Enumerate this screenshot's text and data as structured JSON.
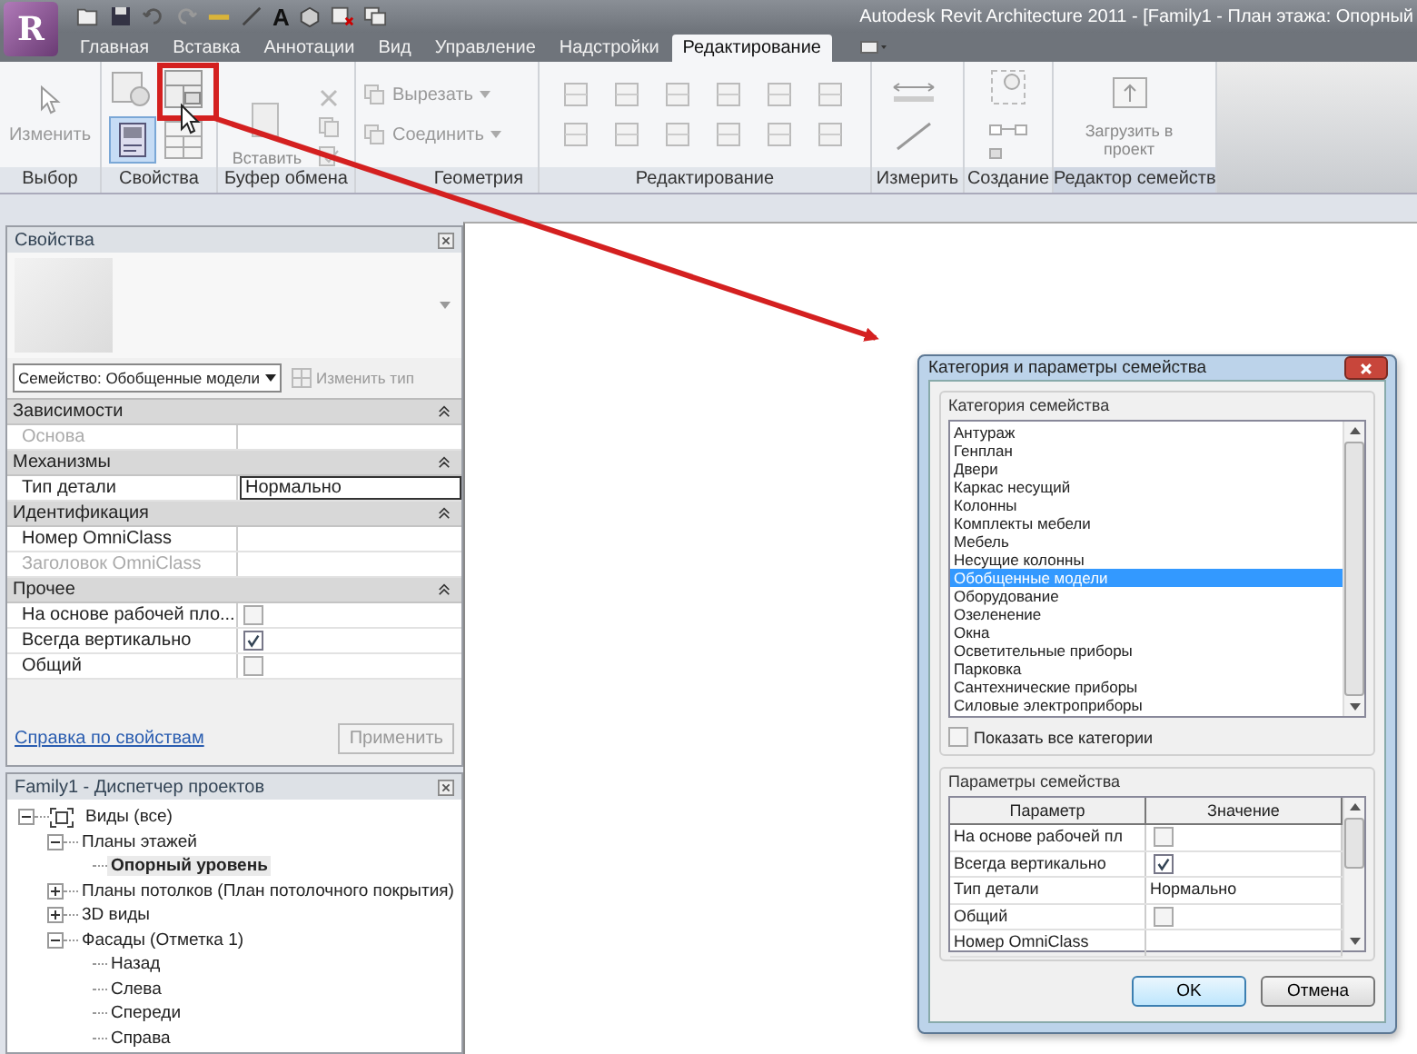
{
  "app": {
    "logo": "R",
    "title": "Autodesk Revit Architecture 2011 - [Family1 - План этажа: Опорный"
  },
  "quick_access": {
    "text_tool": "A"
  },
  "tabs": [
    {
      "label": "Главная",
      "selected": false
    },
    {
      "label": "Вставка",
      "selected": false
    },
    {
      "label": "Аннотации",
      "selected": false
    },
    {
      "label": "Вид",
      "selected": false
    },
    {
      "label": "Управление",
      "selected": false
    },
    {
      "label": "Надстройки",
      "selected": false
    },
    {
      "label": "Редактирование",
      "selected": true
    }
  ],
  "ribbon": {
    "panels": [
      {
        "label": "Выбор",
        "buttons": [
          "Изменить"
        ]
      },
      {
        "label": "Свойства",
        "toggle_on": true
      },
      {
        "label": "Буфер обмена",
        "buttons": [
          "Вставить"
        ]
      },
      {
        "label": "Геометрия",
        "buttons": [
          "Вырезать",
          "Соединить"
        ]
      },
      {
        "label": "Редактирование"
      },
      {
        "label": "Измерить"
      },
      {
        "label": "Создание"
      },
      {
        "label": "Редактор семейств",
        "buttons": [
          "Загрузить в проект"
        ]
      }
    ]
  },
  "properties": {
    "title": "Свойства",
    "family_selector": "Семейство: Обобщенные модели",
    "edit_type": "Изменить тип",
    "groups": [
      {
        "name": "Зависимости",
        "rows": [
          {
            "label": "Основа",
            "kind": "text",
            "disabled": true
          }
        ]
      },
      {
        "name": "Механизмы",
        "rows": [
          {
            "label": "Тип детали",
            "kind": "text",
            "value": "Нормально",
            "disabled": false
          }
        ]
      },
      {
        "name": "Идентификация",
        "rows": [
          {
            "label": "Номер OmniClass",
            "kind": "text",
            "disabled": false
          },
          {
            "label": "Заголовок OmniClass",
            "kind": "text",
            "disabled": true
          }
        ]
      },
      {
        "name": "Прочее",
        "rows": [
          {
            "label": "На основе рабочей пло...",
            "kind": "checkbox",
            "checked": false,
            "disabled": false
          },
          {
            "label": "Всегда вертикально",
            "kind": "checkbox",
            "checked": true,
            "disabled": false
          },
          {
            "label": "Общий",
            "kind": "checkbox",
            "checked": false,
            "disabled": false
          }
        ]
      }
    ],
    "help_link": "Справка по свойствам",
    "apply": "Применить"
  },
  "browser": {
    "title": "Family1 - Диспетчер проектов",
    "tree": [
      {
        "label": "Виды (все)",
        "expanded": true,
        "selected": false,
        "children": [
          {
            "label": "Планы этажей",
            "expanded": true,
            "selected": false,
            "children": [
              {
                "label": "Опорный уровень",
                "selected": true
              }
            ]
          },
          {
            "label": "Планы потолков (План потолочного покрытия)",
            "expanded": false,
            "selected": false
          },
          {
            "label": "3D виды",
            "expanded": false,
            "selected": false
          },
          {
            "label": "Фасады (Отметка 1)",
            "expanded": true,
            "selected": false,
            "children": [
              {
                "label": "Назад",
                "selected": false
              },
              {
                "label": "Слева",
                "selected": false
              },
              {
                "label": "Спереди",
                "selected": false
              },
              {
                "label": "Справа",
                "selected": false
              }
            ]
          }
        ]
      }
    ]
  },
  "dialog": {
    "title": "Категория и параметры семейства",
    "category_group": "Категория семейства",
    "categories": [
      {
        "label": "Антураж",
        "selected": false
      },
      {
        "label": "Генплан",
        "selected": false
      },
      {
        "label": "Двери",
        "selected": false
      },
      {
        "label": "Каркас несущий",
        "selected": false
      },
      {
        "label": "Колонны",
        "selected": false
      },
      {
        "label": "Комплекты мебели",
        "selected": false
      },
      {
        "label": "Мебель",
        "selected": false
      },
      {
        "label": "Несущие колонны",
        "selected": false
      },
      {
        "label": "Обобщенные модели",
        "selected": true
      },
      {
        "label": "Оборудование",
        "selected": false
      },
      {
        "label": "Озеленение",
        "selected": false
      },
      {
        "label": "Окна",
        "selected": false
      },
      {
        "label": "Осветительные приборы",
        "selected": false
      },
      {
        "label": "Парковка",
        "selected": false
      },
      {
        "label": "Сантехнические приборы",
        "selected": false
      },
      {
        "label": "Силовые электроприборы",
        "selected": false
      }
    ],
    "show_all": {
      "label": "Показать все категории",
      "checked": false
    },
    "params_group": "Параметры семейства",
    "columns": [
      "Параметр",
      "Значение"
    ],
    "params": [
      {
        "label": "На основе рабочей пл",
        "kind": "checkbox",
        "checked": false
      },
      {
        "label": "Всегда вертикально",
        "kind": "checkbox",
        "checked": true
      },
      {
        "label": "Тип детали",
        "kind": "text",
        "value": "Нормально"
      },
      {
        "label": "Общий",
        "kind": "checkbox",
        "checked": false
      },
      {
        "label": "Номер OmniClass",
        "kind": "text"
      }
    ],
    "buttons": [
      {
        "label": "OK",
        "kind": "default"
      },
      {
        "label": "Отмена",
        "kind": "normal"
      }
    ]
  }
}
